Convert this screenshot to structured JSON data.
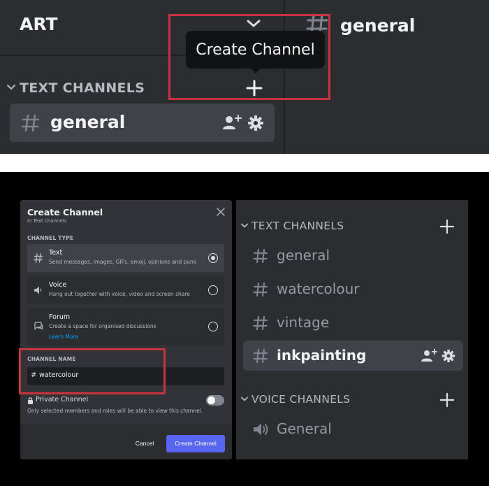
{
  "top": {
    "server_name": "ART",
    "channel_header": "general",
    "tooltip": "Create Channel",
    "category": "TEXT CHANNELS",
    "channel": "general"
  },
  "modal": {
    "title": "Create Channel",
    "subtitle": "in Text channels",
    "channel_type_label": "CHANNEL TYPE",
    "options": [
      {
        "title": "Text",
        "desc": "Send messages, images, GIFs, emoji, opinions and puns",
        "selected": true,
        "icon": "hash-icon"
      },
      {
        "title": "Voice",
        "desc": "Hang out together with voice, video and screen share",
        "selected": false,
        "icon": "speaker-icon"
      },
      {
        "title": "Forum",
        "desc": "Create a space for organised discussions",
        "link": "Learn More",
        "selected": false,
        "icon": "forum-icon"
      }
    ],
    "channel_name_label": "CHANNEL NAME",
    "channel_name_prefix": "#",
    "channel_name_value": "watercolour",
    "private_label": "Private Channel",
    "private_desc": "Only selected members and roles will be able to view this channel.",
    "private_enabled": false,
    "cancel_label": "Cancel",
    "create_label": "Create Channel"
  },
  "sidebar": {
    "text_category": "TEXT CHANNELS",
    "text_channels": [
      {
        "name": "general",
        "active": false
      },
      {
        "name": "watercolour",
        "active": false
      },
      {
        "name": "vintage",
        "active": false
      },
      {
        "name": "inkpainting",
        "active": true
      }
    ],
    "voice_category": "VOICE CHANNELS",
    "voice_channels": [
      {
        "name": "General"
      }
    ]
  },
  "colors": {
    "bg_dark": "#2b2d31",
    "modal_bg": "#313338",
    "active_row": "#404249",
    "accent": "#5865f2",
    "highlight": "#c8333e",
    "link": "#00a8fc"
  }
}
